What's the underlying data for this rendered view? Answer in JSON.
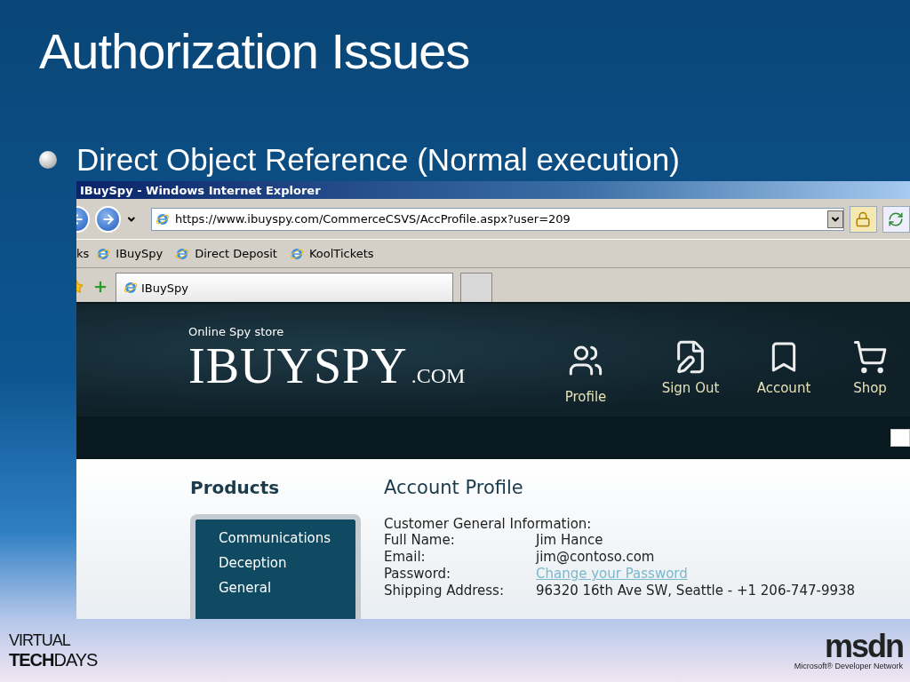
{
  "slide": {
    "title": "Authorization Issues",
    "bullet": "Direct Object Reference (Normal execution)"
  },
  "browser": {
    "title": "IBuySpy - Windows Internet Explorer",
    "address": "https://www.ibuyspy.com/CommerceCSVS/AccProfile.aspx?user=209",
    "links_label": "ks",
    "links": [
      "IBuySpy",
      "Direct Deposit",
      "KoolTickets"
    ],
    "tabs": [
      {
        "label": "IBuySpy",
        "selected": true
      }
    ]
  },
  "site": {
    "tagline": "Online Spy store",
    "logo": "IBUYSPY",
    "logo_suffix": ".COM",
    "nav": [
      {
        "label": "Profile",
        "kind": "people",
        "selected": true
      },
      {
        "label": "Sign Out",
        "kind": "document",
        "selected": false
      },
      {
        "label": "Account",
        "kind": "book",
        "selected": false
      },
      {
        "label": "Shop",
        "kind": "cart",
        "selected": false
      }
    ],
    "sidebar": {
      "heading": "Products",
      "items": [
        "Communications",
        "Deception",
        "General"
      ]
    },
    "content": {
      "heading": "Account Profile",
      "section": "Customer General Information:",
      "fields": [
        {
          "label": "Full Name:",
          "value": "Jim Hance",
          "kind": "text"
        },
        {
          "label": "Email:",
          "value": "jim@contoso.com",
          "kind": "text"
        },
        {
          "label": "Password:",
          "value": "Change your Password",
          "kind": "link"
        },
        {
          "label": "Shipping Address:",
          "value": "96320 16th Ave SW, Seattle - +1 206-747-9938",
          "kind": "text"
        }
      ]
    }
  },
  "footer": {
    "left_logo_top": "VIRTUAL",
    "left_logo_bottom": "**TECH**DAYS",
    "right_logo": "msdn",
    "right_logo_caption": "Microsoft® Developer Network"
  }
}
